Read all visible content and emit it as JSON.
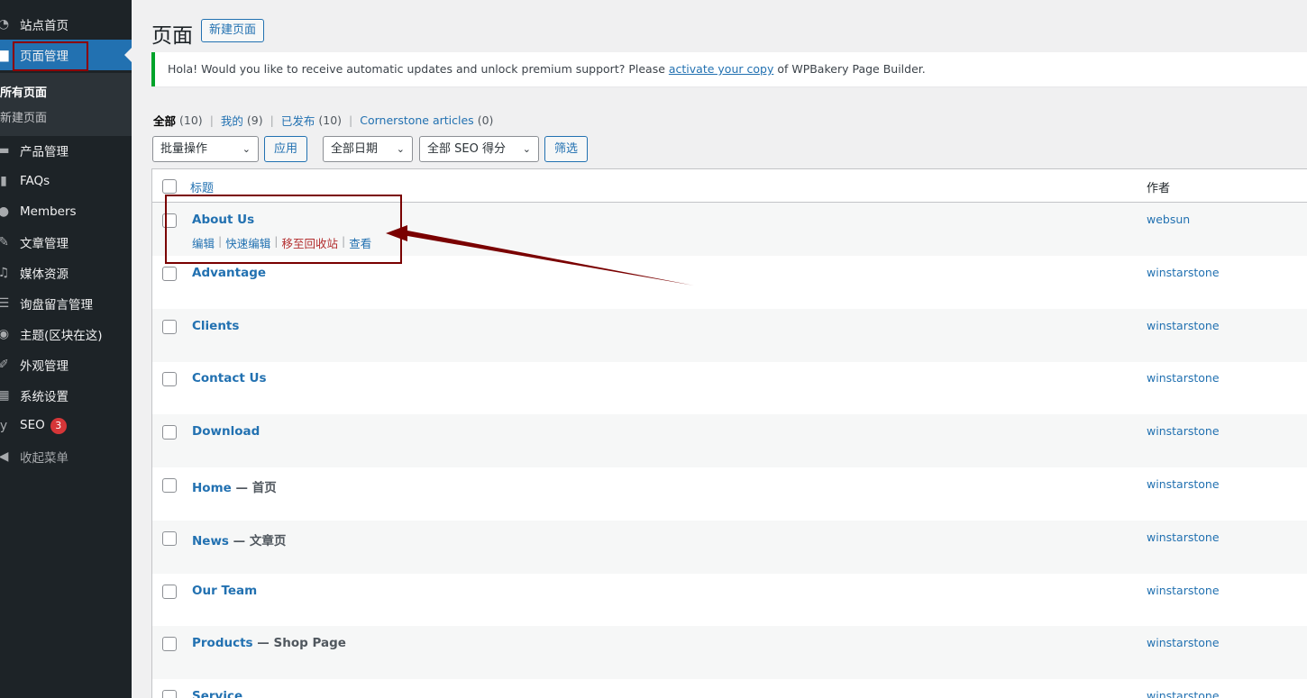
{
  "sidebar": {
    "items": [
      {
        "label": "站点首页",
        "icon": "dashboard-icon"
      },
      {
        "label": "页面管理",
        "icon": "page-icon",
        "active": true
      },
      {
        "label": "产品管理",
        "icon": "product-icon"
      },
      {
        "label": "FAQs",
        "icon": "book-icon"
      },
      {
        "label": "Members",
        "icon": "user-icon"
      },
      {
        "label": "文章管理",
        "icon": "pin-icon"
      },
      {
        "label": "媒体资源",
        "icon": "media-icon"
      },
      {
        "label": "询盘留言管理",
        "icon": "form-icon"
      },
      {
        "label": "主题(区块在这)",
        "icon": "theme-icon"
      },
      {
        "label": "外观管理",
        "icon": "brush-icon"
      },
      {
        "label": "系统设置",
        "icon": "settings-icon"
      },
      {
        "label": "SEO",
        "icon": "yoast-icon",
        "badge": "3"
      },
      {
        "label": "收起菜单",
        "icon": "collapse-icon"
      }
    ],
    "submenu": [
      {
        "label": "所有页面",
        "current": true
      },
      {
        "label": "新建页面",
        "current": false
      }
    ]
  },
  "header": {
    "title": "页面",
    "new_button": "新建页面"
  },
  "notice": {
    "before": "Hola! Would you like to receive automatic updates and unlock premium support? Please ",
    "link": "activate your copy",
    "after": " of WPBakery Page Builder."
  },
  "views": [
    {
      "name": "全部",
      "count": "(10)"
    },
    {
      "name": "我的",
      "count": "(9)"
    },
    {
      "name": "已发布",
      "count": "(10)"
    },
    {
      "name": "Cornerstone articles",
      "count": "(0)"
    }
  ],
  "filters": {
    "bulk_actions": "批量操作",
    "apply": "应用",
    "all_dates": "全部日期",
    "all_seo": "全部 SEO 得分",
    "filter": "筛选"
  },
  "table": {
    "col_title": "标题",
    "col_author": "作者",
    "rows": [
      {
        "title": "About Us",
        "suffix": "",
        "author": "websun"
      },
      {
        "title": "Advantage",
        "suffix": "",
        "author": "winstarstone"
      },
      {
        "title": "Clients",
        "suffix": "",
        "author": "winstarstone"
      },
      {
        "title": "Contact Us",
        "suffix": "",
        "author": "winstarstone"
      },
      {
        "title": "Download",
        "suffix": "",
        "author": "winstarstone"
      },
      {
        "title": "Home",
        "suffix": " — 首页",
        "author": "winstarstone"
      },
      {
        "title": "News",
        "suffix": " — 文章页",
        "author": "winstarstone"
      },
      {
        "title": "Our Team",
        "suffix": "",
        "author": "winstarstone"
      },
      {
        "title": "Products",
        "suffix": " — Shop Page",
        "author": "winstarstone"
      },
      {
        "title": "Service",
        "suffix": "",
        "author": "winstarstone"
      }
    ],
    "row_actions": {
      "edit": "编辑",
      "quick_edit": "快速编辑",
      "trash": "移至回收站",
      "view": "查看"
    }
  },
  "colors": {
    "sidebar_bg": "#1d2327",
    "accent": "#2271b1",
    "annotation": "#7a0000",
    "notice_border": "#00a32a"
  }
}
